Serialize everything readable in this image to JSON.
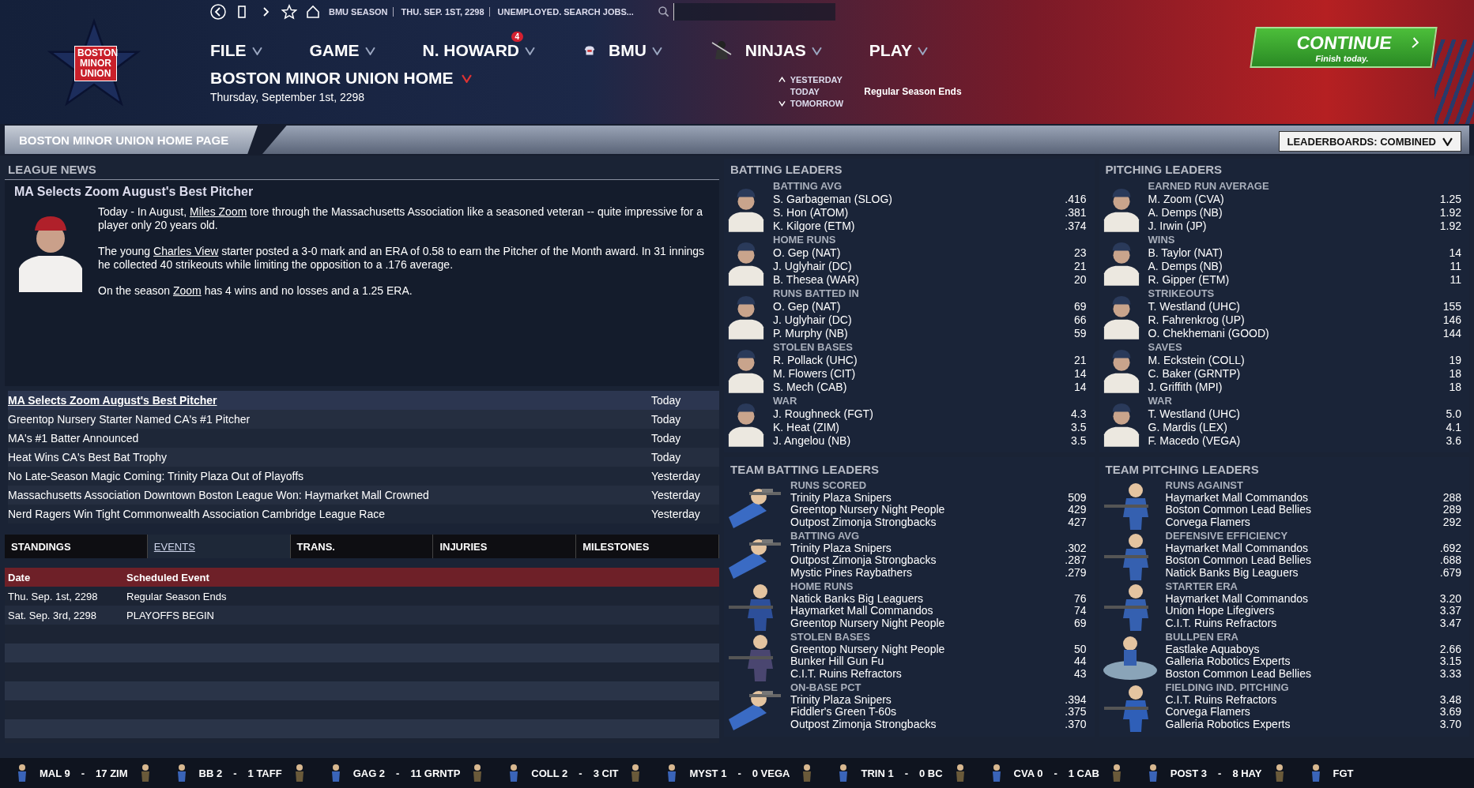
{
  "logo": {
    "lines": [
      "BOSTON",
      "MINOR",
      "UNION"
    ]
  },
  "toolbar": {
    "season": "BMU SEASON",
    "date": "THU. SEP. 1ST, 2298",
    "status": "UNEMPLOYED. SEARCH JOBS..."
  },
  "menu": [
    {
      "label": "FILE",
      "kind": "plain"
    },
    {
      "label": "GAME",
      "kind": "plain"
    },
    {
      "label": "N. HOWARD",
      "kind": "plain",
      "badge": "4"
    },
    {
      "label": "BMU",
      "kind": "jersey"
    },
    {
      "label": "NINJAS",
      "kind": "ninja"
    },
    {
      "label": "PLAY",
      "kind": "plain"
    }
  ],
  "page_title": "BOSTON MINOR UNION HOME",
  "page_date": "Thursday, September 1st, 2298",
  "day_nav": {
    "previous": "YESTERDAY",
    "current": "TODAY",
    "next": "TOMORROW",
    "event": "Regular Season Ends"
  },
  "continue_button": {
    "label": "CONTINUE",
    "sublabel": "Finish today."
  },
  "breadcrumb": "BOSTON MINOR UNION HOME PAGE",
  "leaderboard_dropdown": "LEADERBOARDS: COMBINED",
  "league_news": {
    "title": "LEAGUE NEWS",
    "article": {
      "headline": "MA Selects Zoom August's Best Pitcher",
      "paragraphs": [
        [
          {
            "text": "Today - In August, ",
            "link": false
          },
          {
            "text": "Miles Zoom",
            "link": true
          },
          {
            "text": " tore through the Massachusetts Association like a seasoned veteran -- quite impressive for a player only 20 years old.",
            "link": false
          }
        ],
        [
          {
            "text": "The young ",
            "link": false
          },
          {
            "text": "Charles View",
            "link": true
          },
          {
            "text": " starter posted a 3-0 mark and an ERA of 0.58 to earn the Pitcher of the Month award. In 31 innings he collected 40 strikeouts while limiting the opposition to a .176 average.",
            "link": false
          }
        ],
        [
          {
            "text": "On the season ",
            "link": false
          },
          {
            "text": "Zoom",
            "link": true
          },
          {
            "text": " has 4 wins and no losses and a 1.25 ERA.",
            "link": false
          }
        ]
      ]
    },
    "items": [
      {
        "title": "MA Selects Zoom August's Best Pitcher",
        "when": "Today",
        "selected": true
      },
      {
        "title": "Greentop Nursery Starter Named CA's #1 Pitcher",
        "when": "Today",
        "selected": false
      },
      {
        "title": "MA's #1 Batter Announced",
        "when": "Today",
        "selected": false
      },
      {
        "title": "Heat Wins CA's Best Bat Trophy",
        "when": "Today",
        "selected": false
      },
      {
        "title": "No Late-Season Magic Coming: Trinity Plaza Out of Playoffs",
        "when": "Yesterday",
        "selected": false
      },
      {
        "title": "Massachusetts Association Downtown Boston League Won: Haymarket Mall Crowned",
        "when": "Yesterday",
        "selected": false
      },
      {
        "title": "Nerd Ragers Win Tight Commonwealth Association Cambridge League Race",
        "when": "Yesterday",
        "selected": false
      }
    ]
  },
  "tabs": [
    {
      "label": "STANDINGS",
      "selected": false
    },
    {
      "label": "EVENTS",
      "selected": true
    },
    {
      "label": "TRANS.",
      "selected": false
    },
    {
      "label": "INJURIES",
      "selected": false
    },
    {
      "label": "MILESTONES",
      "selected": false
    }
  ],
  "events_table": {
    "columns": [
      "Date",
      "Scheduled Event"
    ],
    "rows": [
      [
        "Thu. Sep. 1st, 2298",
        "Regular Season Ends"
      ],
      [
        "Sat. Sep. 3rd, 2298",
        "PLAYOFFS BEGIN"
      ]
    ]
  },
  "batting_leaders": {
    "title": "BATTING LEADERS",
    "categories": [
      {
        "label": "BATTING AVG",
        "rows": [
          [
            "S. Garbageman (SLOG)",
            ".416"
          ],
          [
            "S. Hon (ATOM)",
            ".381"
          ],
          [
            "K. Kilgore (ETM)",
            ".374"
          ]
        ]
      },
      {
        "label": "HOME RUNS",
        "rows": [
          [
            "O. Gep (NAT)",
            "23"
          ],
          [
            "J. Uglyhair (DC)",
            "21"
          ],
          [
            "B. Thesea (WAR)",
            "20"
          ]
        ]
      },
      {
        "label": "RUNS BATTED IN",
        "rows": [
          [
            "O. Gep (NAT)",
            "69"
          ],
          [
            "J. Uglyhair (DC)",
            "66"
          ],
          [
            "P. Murphy (NB)",
            "59"
          ]
        ]
      },
      {
        "label": "STOLEN BASES",
        "rows": [
          [
            "R. Pollack (UHC)",
            "21"
          ],
          [
            "M. Flowers (CIT)",
            "14"
          ],
          [
            "S. Mech (CAB)",
            "14"
          ]
        ]
      },
      {
        "label": "WAR",
        "rows": [
          [
            "J. Roughneck (FGT)",
            "4.3"
          ],
          [
            "K. Heat (ZIM)",
            "3.5"
          ],
          [
            "J. Angelou (NB)",
            "3.5"
          ]
        ]
      }
    ]
  },
  "pitching_leaders": {
    "title": "PITCHING LEADERS",
    "categories": [
      {
        "label": "EARNED RUN AVERAGE",
        "rows": [
          [
            "M. Zoom (CVA)",
            "1.25"
          ],
          [
            "A. Demps (NB)",
            "1.92"
          ],
          [
            "J. Irwin (JP)",
            "1.92"
          ]
        ]
      },
      {
        "label": "WINS",
        "rows": [
          [
            "B. Taylor (NAT)",
            "14"
          ],
          [
            "A. Demps (NB)",
            "11"
          ],
          [
            "R. Gipper (ETM)",
            "11"
          ]
        ]
      },
      {
        "label": "STRIKEOUTS",
        "rows": [
          [
            "T. Westland (UHC)",
            "155"
          ],
          [
            "R. Fahrenkrog (UP)",
            "146"
          ],
          [
            "O. Chekhemani (GOOD)",
            "144"
          ]
        ]
      },
      {
        "label": "SAVES",
        "rows": [
          [
            "M. Eckstein (COLL)",
            "19"
          ],
          [
            "C. Baker (GRNTP)",
            "18"
          ],
          [
            "J. Griffith (MPI)",
            "18"
          ]
        ]
      },
      {
        "label": "WAR",
        "rows": [
          [
            "T. Westland (UHC)",
            "5.0"
          ],
          [
            "G. Mardis (LEX)",
            "4.1"
          ],
          [
            "F. Macedo (VEGA)",
            "3.6"
          ]
        ]
      }
    ]
  },
  "team_batting_leaders": {
    "title": "TEAM BATTING LEADERS",
    "categories": [
      {
        "label": "RUNS SCORED",
        "kind": "sniper",
        "rows": [
          [
            "Trinity Plaza Snipers",
            "509"
          ],
          [
            "Greentop Nursery Night People",
            "429"
          ],
          [
            "Outpost Zimonja Strongbacks",
            "427"
          ]
        ]
      },
      {
        "label": "BATTING AVG",
        "kind": "sniper",
        "rows": [
          [
            "Trinity Plaza Snipers",
            ".302"
          ],
          [
            "Outpost Zimonja Strongbacks",
            ".287"
          ],
          [
            "Mystic Pines Raybathers",
            ".279"
          ]
        ]
      },
      {
        "label": "HOME RUNS",
        "kind": "batter",
        "rows": [
          [
            "Natick Banks Big Leaguers",
            "76"
          ],
          [
            "Haymarket Mall Commandos",
            "74"
          ],
          [
            "Greentop Nursery Night People",
            "69"
          ]
        ]
      },
      {
        "label": "STOLEN BASES",
        "kind": "cloak",
        "rows": [
          [
            "Greentop Nursery Night People",
            "50"
          ],
          [
            "Bunker Hill Gun Fu",
            "44"
          ],
          [
            "C.I.T. Ruins Refractors",
            "43"
          ]
        ]
      },
      {
        "label": "ON-BASE PCT",
        "kind": "sniper",
        "rows": [
          [
            "Trinity Plaza Snipers",
            ".394"
          ],
          [
            "Fiddler's Green T-60s",
            ".375"
          ],
          [
            "Outpost Zimonja Strongbacks",
            ".370"
          ]
        ]
      }
    ]
  },
  "team_pitching_leaders": {
    "title": "TEAM PITCHING LEADERS",
    "categories": [
      {
        "label": "RUNS AGAINST",
        "kind": "soldier",
        "rows": [
          [
            "Haymarket Mall Commandos",
            "288"
          ],
          [
            "Boston Common Lead Bellies",
            "289"
          ],
          [
            "Corvega Flamers",
            "292"
          ]
        ]
      },
      {
        "label": "DEFENSIVE EFFICIENCY",
        "kind": "soldier",
        "rows": [
          [
            "Haymarket Mall Commandos",
            ".692"
          ],
          [
            "Boston Common Lead Bellies",
            ".688"
          ],
          [
            "Natick Banks Big Leaguers",
            ".679"
          ]
        ]
      },
      {
        "label": "STARTER ERA",
        "kind": "soldier",
        "rows": [
          [
            "Haymarket Mall Commandos",
            "3.20"
          ],
          [
            "Union Hope Lifegivers",
            "3.37"
          ],
          [
            "C.I.T. Ruins Refractors",
            "3.47"
          ]
        ]
      },
      {
        "label": "BULLPEN ERA",
        "kind": "pool",
        "rows": [
          [
            "Eastlake Aquaboys",
            "2.66"
          ],
          [
            "Galleria Robotics Experts",
            "3.15"
          ],
          [
            "Boston Common Lead Bellies",
            "3.33"
          ]
        ]
      },
      {
        "label": "FIELDING IND. PITCHING",
        "kind": "vaultboy",
        "rows": [
          [
            "C.I.T. Ruins Refractors",
            "3.48"
          ],
          [
            "Corvega Flamers",
            "3.69"
          ],
          [
            "Galleria Robotics Experts",
            "3.70"
          ]
        ]
      }
    ]
  },
  "ticker": [
    {
      "away": "MAL 9",
      "sep": "-",
      "home": "17 ZIM"
    },
    {
      "away": "BB 2",
      "sep": "-",
      "home": "1 TAFF"
    },
    {
      "away": "GAG 2",
      "sep": "-",
      "home": "11 GRNTP"
    },
    {
      "away": "COLL 2",
      "sep": "-",
      "home": "3 CIT"
    },
    {
      "away": "MYST 1",
      "sep": "-",
      "home": "0 VEGA"
    },
    {
      "away": "TRIN 1",
      "sep": "-",
      "home": "0 BC"
    },
    {
      "away": "CVA 0",
      "sep": "-",
      "home": "1 CAB"
    },
    {
      "away": "POST 3",
      "sep": "-",
      "home": "8 HAY"
    },
    {
      "away": "FGT"
    }
  ]
}
